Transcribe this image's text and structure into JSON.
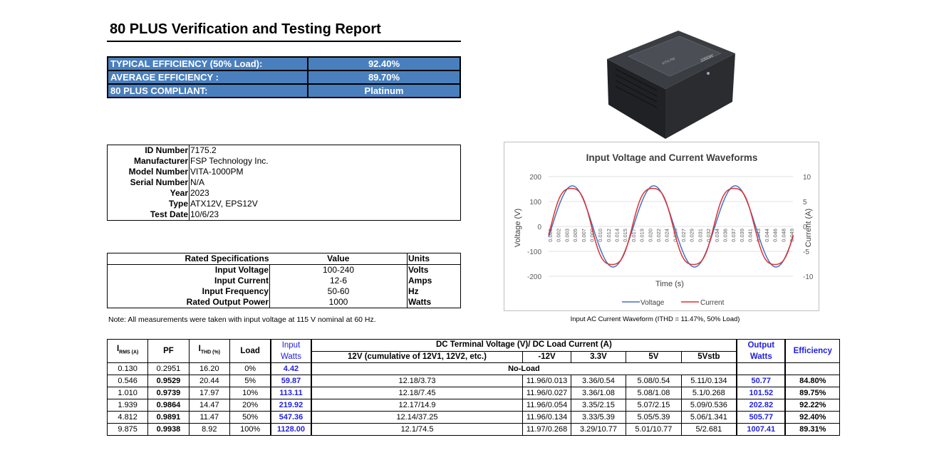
{
  "title": "80 PLUS Verification and Testing Report",
  "efficiency": [
    {
      "label": "TYPICAL EFFICIENCY (50% Load):",
      "value": "92.40%"
    },
    {
      "label": "AVERAGE EFFICIENCY :",
      "value": "89.70%"
    },
    {
      "label": "80 PLUS COMPLIANT:",
      "value": "Platinum"
    }
  ],
  "product_image": {
    "brand_text": "VITA PM",
    "model_text": "1000W"
  },
  "id_info": [
    {
      "key": "ID Number",
      "value": "7175.2"
    },
    {
      "key": "Manufacturer",
      "value": "FSP Technology Inc."
    },
    {
      "key": "Model Number",
      "value": "VITA-1000PM"
    },
    {
      "key": "Serial Number",
      "value": "N/A"
    },
    {
      "key": "Year",
      "value": "2023"
    },
    {
      "key": "Type",
      "value": "ATX12V, EPS12V"
    },
    {
      "key": "Test Date",
      "value": "10/6/23"
    }
  ],
  "rated_specs": {
    "headers": [
      "Rated Specifications",
      "Value",
      "Units"
    ],
    "rows": [
      {
        "name": "Input Voltage",
        "value": "100-240",
        "unit": "Volts"
      },
      {
        "name": "Input Current",
        "value": "12-6",
        "unit": "Amps"
      },
      {
        "name": "Input Frequency",
        "value": "50-60",
        "unit": "Hz"
      },
      {
        "name": "Rated Output Power",
        "value": "1000",
        "unit": "Watts"
      }
    ]
  },
  "note": "Note: All measurements were taken with input voltage at 115 V nominal at 60 Hz.",
  "chart_caption": "Input AC Current Waveform (ITHD = 11.47%, 50% Load)",
  "chart_data": {
    "type": "line",
    "title": "Input Voltage and Current Waveforms",
    "xlabel": "Time (s)",
    "ylabel": "Voltage (V)",
    "y2label": "Current (A)",
    "ylim": [
      -200,
      200
    ],
    "y2lim": [
      -10,
      10
    ],
    "yticks": [
      "200",
      "100",
      "0",
      "-100",
      "-200"
    ],
    "y2ticks": [
      "10",
      "5",
      "0",
      "-5",
      "-10"
    ],
    "x_ticks": [
      "0.000",
      "0.002",
      "0.003",
      "0.005",
      "0.007",
      "0.009",
      "0.010",
      "0.012",
      "0.014",
      "0.015",
      "0.017",
      "0.019",
      "0.020",
      "0.022",
      "0.024",
      "0.026",
      "0.027",
      "0.029",
      "0.031",
      "0.032",
      "0.034",
      "0.036",
      "0.037",
      "0.039",
      "0.041",
      "0.043",
      "0.044",
      "0.046",
      "0.048",
      "0.049"
    ],
    "legend": "bottom",
    "colors": {
      "Voltage": "#4472c4",
      "Current": "#e03030"
    },
    "series": [
      {
        "name": "Voltage",
        "axis": "left",
        "amplitude": 163,
        "frequency_hz": 60,
        "phase_deg": -15
      },
      {
        "name": "Current",
        "axis": "right",
        "amplitude": 8.3,
        "frequency_hz": 60,
        "phase_deg": -10
      }
    ],
    "x_range": [
      0,
      0.05
    ]
  },
  "main_table": {
    "header1": {
      "irms": "I",
      "irms_sub": "RMS (A)",
      "pf": "PF",
      "ithd": "I",
      "ithd_sub": "THD (%)",
      "load": "Load",
      "input_watts": "Input Watts",
      "dc_group": "DC Terminal Voltage (V)/ DC Load Current (A)",
      "output_watts": "Output Watts",
      "efficiency": "Efficiency"
    },
    "dc_cols": [
      "12V (cumulative of 12V1, 12V2, etc.)",
      "-12V",
      "3.3V",
      "5V",
      "5Vstb"
    ],
    "no_load": {
      "irms": "0.130",
      "pf": "0.2951",
      "ithd": "16.20",
      "load": "0%",
      "input": "4.42",
      "label": "No-Load"
    },
    "rows": [
      {
        "irms": "0.546",
        "pf": "0.9529",
        "ithd": "20.44",
        "load": "5%",
        "input": "59.87",
        "v12": "12.18/3.73",
        "m12": "11.96/0.013",
        "v33": "3.36/0.54",
        "v5": "5.08/0.54",
        "v5sb": "5.11/0.134",
        "out": "50.77",
        "eff": "84.80%"
      },
      {
        "irms": "1.010",
        "pf": "0.9739",
        "ithd": "17.97",
        "load": "10%",
        "input": "113.11",
        "v12": "12.18/7.45",
        "m12": "11.96/0.027",
        "v33": "3.36/1.08",
        "v5": "5.08/1.08",
        "v5sb": "5.1/0.268",
        "out": "101.52",
        "eff": "89.75%"
      },
      {
        "irms": "1.939",
        "pf": "0.9864",
        "ithd": "14.47",
        "load": "20%",
        "input": "219.92",
        "v12": "12.17/14.9",
        "m12": "11.96/0.054",
        "v33": "3.35/2.15",
        "v5": "5.07/2.15",
        "v5sb": "5.09/0.536",
        "out": "202.82",
        "eff": "92.22%"
      },
      {
        "irms": "4.812",
        "pf": "0.9891",
        "ithd": "11.47",
        "load": "50%",
        "input": "547.36",
        "v12": "12.14/37.25",
        "m12": "11.96/0.134",
        "v33": "3.33/5.39",
        "v5": "5.05/5.39",
        "v5sb": "5.06/1.341",
        "out": "505.77",
        "eff": "92.40%"
      },
      {
        "irms": "9.875",
        "pf": "0.9938",
        "ithd": "8.92",
        "load": "100%",
        "input": "1128.00",
        "v12": "12.1/74.5",
        "m12": "11.97/0.268",
        "v33": "3.29/10.77",
        "v5": "5.01/10.77",
        "v5sb": "5/2.681",
        "out": "1007.41",
        "eff": "89.31%"
      }
    ]
  }
}
